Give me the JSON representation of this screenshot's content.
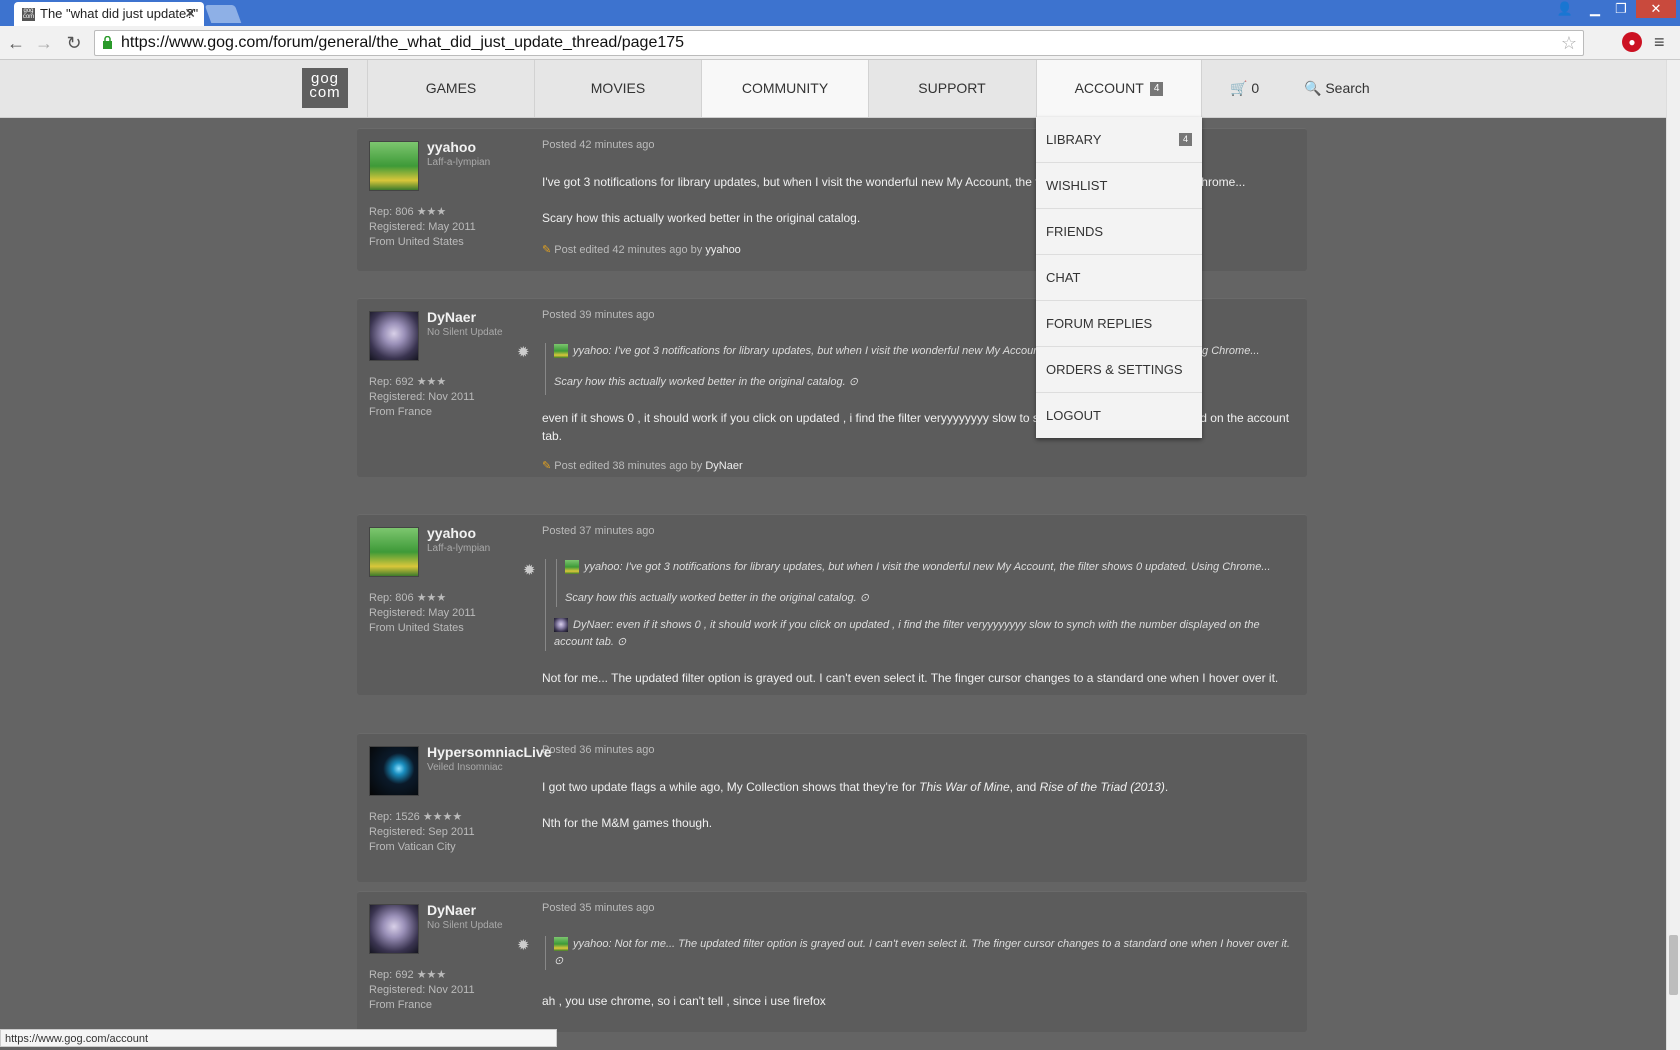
{
  "browser": {
    "tab_title": "The \"what did just update?\"",
    "url": "https://www.gog.com/forum/general/the_what_did_just_update_thread/page175",
    "status_url": "https://www.gog.com/account"
  },
  "header": {
    "logo": "gog com",
    "nav": [
      "GAMES",
      "MOVIES",
      "COMMUNITY",
      "SUPPORT"
    ],
    "account_label": "ACCOUNT",
    "account_badge": "4",
    "cart_count": "0",
    "search_label": "Search"
  },
  "account_menu": {
    "items": [
      "LIBRARY",
      "WISHLIST",
      "FRIENDS",
      "CHAT",
      "FORUM REPLIES",
      "ORDERS & SETTINGS",
      "LOGOUT"
    ],
    "library_badge": "4"
  },
  "posts": [
    {
      "user": "yyahoo",
      "title": "Laff-a-lympian",
      "rep": "Rep: 806 ★★★",
      "registered": "Registered: May 2011",
      "from": "From United States",
      "posted": "Posted 42 minutes ago",
      "body1": "I've got 3 notifications for library updates, but when I visit the wonderful new My Account, the filter shows 0 updated. Using Chrome...",
      "body2": "Scary how this actually worked better in the original catalog.",
      "edited_prefix": "Post edited 42 minutes ago by",
      "edited_by": "yyahoo"
    },
    {
      "user": "DyNaer",
      "title": "No Silent Update",
      "rep": "Rep: 692 ★★★",
      "registered": "Registered: Nov 2011",
      "from": "From France",
      "posted": "Posted 39 minutes ago",
      "quote_author": "yyahoo:",
      "quote1": "I've got 3 notifications for library updates, but when I visit the wonderful new My Account, the filter shows 0 updated. Using Chrome...",
      "quote2": "Scary how this actually worked better in the original catalog.",
      "body1": "even if it shows 0 , it should work if you click on updated , i find the filter veryyyyyyyy slow to synch with the number displayed on the account tab.",
      "edited_prefix": "Post edited 38 minutes ago by",
      "edited_by": "DyNaer"
    },
    {
      "user": "yyahoo",
      "title": "Laff-a-lympian",
      "rep": "Rep: 806 ★★★",
      "registered": "Registered: May 2011",
      "from": "From United States",
      "posted": "Posted 37 minutes ago",
      "quote_author": "yyahoo:",
      "quote1": "I've got 3 notifications for library updates, but when I visit the wonderful new My Account, the filter shows 0 updated. Using Chrome...",
      "quote2": "Scary how this actually worked better in the original catalog.",
      "quote_author2": "DyNaer:",
      "quote3": "even if it shows 0 , it should work if you click on updated , i find the filter veryyyyyyyy slow to synch with the number displayed on the account tab.",
      "body1": "Not for me... The updated filter option is grayed out. I can't even select it. The finger cursor changes to a standard one when I hover over it."
    },
    {
      "user": "HypersomniacLive",
      "title": "Veiled Insomniac",
      "rep": "Rep: 1526 ★★★★",
      "registered": "Registered: Sep 2011",
      "from": "From Vatican City",
      "posted": "Posted 36 minutes ago",
      "body1_pre": "I got two update flags a while ago, My Collection shows that they're for ",
      "body1_em1": "This War of Mine",
      "body1_mid": ", and ",
      "body1_em2": "Rise of the Triad (2013)",
      "body1_post": ".",
      "body2": "Nth for the M&M games though."
    },
    {
      "user": "DyNaer",
      "title": "No Silent Update",
      "rep": "Rep: 692 ★★★",
      "registered": "Registered: Nov 2011",
      "from": "From France",
      "posted": "Posted 35 minutes ago",
      "quote_author": "yyahoo:",
      "quote1": "Not for me... The updated filter option is grayed out. I can't even select it. The finger cursor changes to a standard one when I hover over it.",
      "body1": "ah , you use chrome, so i can't tell , since i use firefox"
    }
  ]
}
